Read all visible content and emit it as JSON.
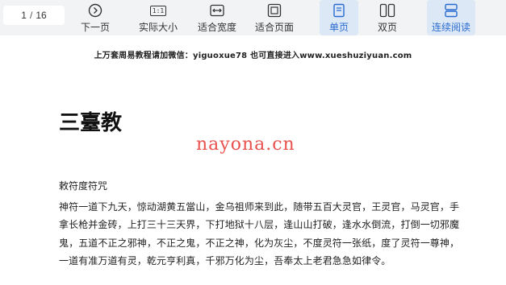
{
  "toolbar": {
    "page_current": "1",
    "page_total": "16",
    "buttons": [
      {
        "label": "下一页",
        "icon": "next-page-icon"
      },
      {
        "label": "实际大小",
        "icon": "actual-size-icon"
      },
      {
        "label": "适合宽度",
        "icon": "fit-width-icon"
      },
      {
        "label": "适合页面",
        "icon": "fit-page-icon"
      },
      {
        "label": "单页",
        "icon": "single-page-icon"
      },
      {
        "label": "双页",
        "icon": "double-page-icon"
      },
      {
        "label": "连续阅读",
        "icon": "continuous-read-icon"
      }
    ],
    "actual_size_glyph": "1:1",
    "accent": "#2a6bd1"
  },
  "document": {
    "header_note": "上万套周易教程请加微信：yiguoxue78  也可直接进入www.xueshuziyuan.com",
    "title": "三臺教",
    "watermark": "nayona.cn",
    "section_heading": "敕符度符咒",
    "body_lines": [
      "神符一道下九天，惊动湖黄五當山，金乌祖师来到此，随带五百大灵官，王灵官，马灵官，手",
      "拿长枪并金砖，上打三十三天界，下打地狱十八层，逢山山打破，逢水水倒流，打倒一切邪魔",
      "鬼，五道不正之邪神，不正之鬼，不正之神，化为灰尘，不度灵符一张纸，度了灵符一尊神，",
      "一道有准万道有灵，乾元亨利真，千邪万化为尘，吾奉太上老君急急如律令。"
    ]
  }
}
